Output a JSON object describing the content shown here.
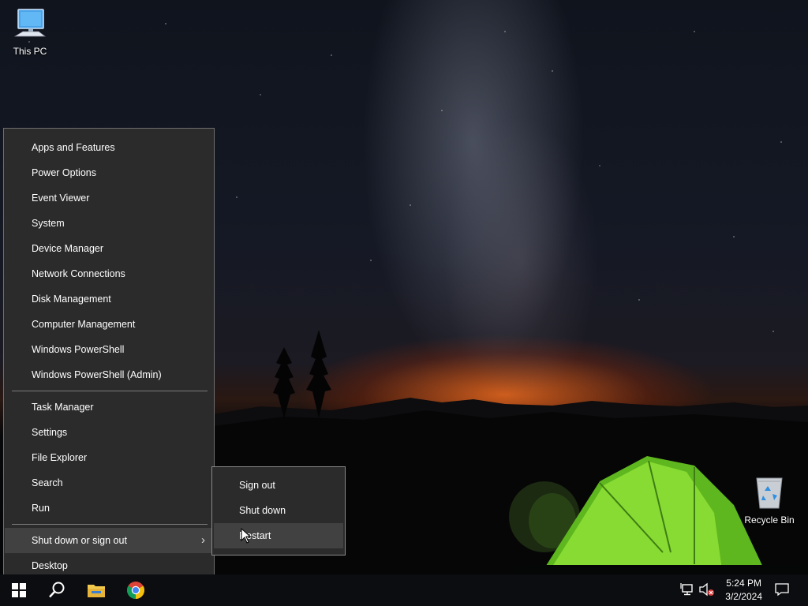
{
  "desktop": {
    "this_pc_label": "This PC",
    "recycle_bin_label": "Recycle Bin"
  },
  "winx_menu": {
    "items": [
      {
        "label": "Apps and Features"
      },
      {
        "label": "Power Options"
      },
      {
        "label": "Event Viewer"
      },
      {
        "label": "System"
      },
      {
        "label": "Device Manager"
      },
      {
        "label": "Network Connections"
      },
      {
        "label": "Disk Management"
      },
      {
        "label": "Computer Management"
      },
      {
        "label": "Windows PowerShell"
      },
      {
        "label": "Windows PowerShell (Admin)"
      },
      {
        "label": "Task Manager"
      },
      {
        "label": "Settings"
      },
      {
        "label": "File Explorer"
      },
      {
        "label": "Search"
      },
      {
        "label": "Run"
      },
      {
        "label": "Shut down or sign out"
      },
      {
        "label": "Desktop"
      }
    ],
    "submenu_chevron": "›"
  },
  "shutdown_submenu": {
    "items": [
      {
        "label": "Sign out"
      },
      {
        "label": "Shut down"
      },
      {
        "label": "Restart"
      }
    ]
  },
  "taskbar": {
    "apps": [
      {
        "icon": "windows-start-icon"
      },
      {
        "icon": "search-icon"
      },
      {
        "icon": "file-explorer-icon"
      },
      {
        "icon": "chrome-icon"
      }
    ],
    "tray_icons": [
      "network-icon",
      "volume-muted-icon"
    ],
    "time": "5:24 PM",
    "date": "3/2/2024",
    "notification_icon": "action-center-icon"
  },
  "colors": {
    "menu_bg": "#2b2b2b",
    "menu_hover": "#414141",
    "taskbar_bg": "#0c0d10",
    "tent_green": "#7cd32a"
  }
}
